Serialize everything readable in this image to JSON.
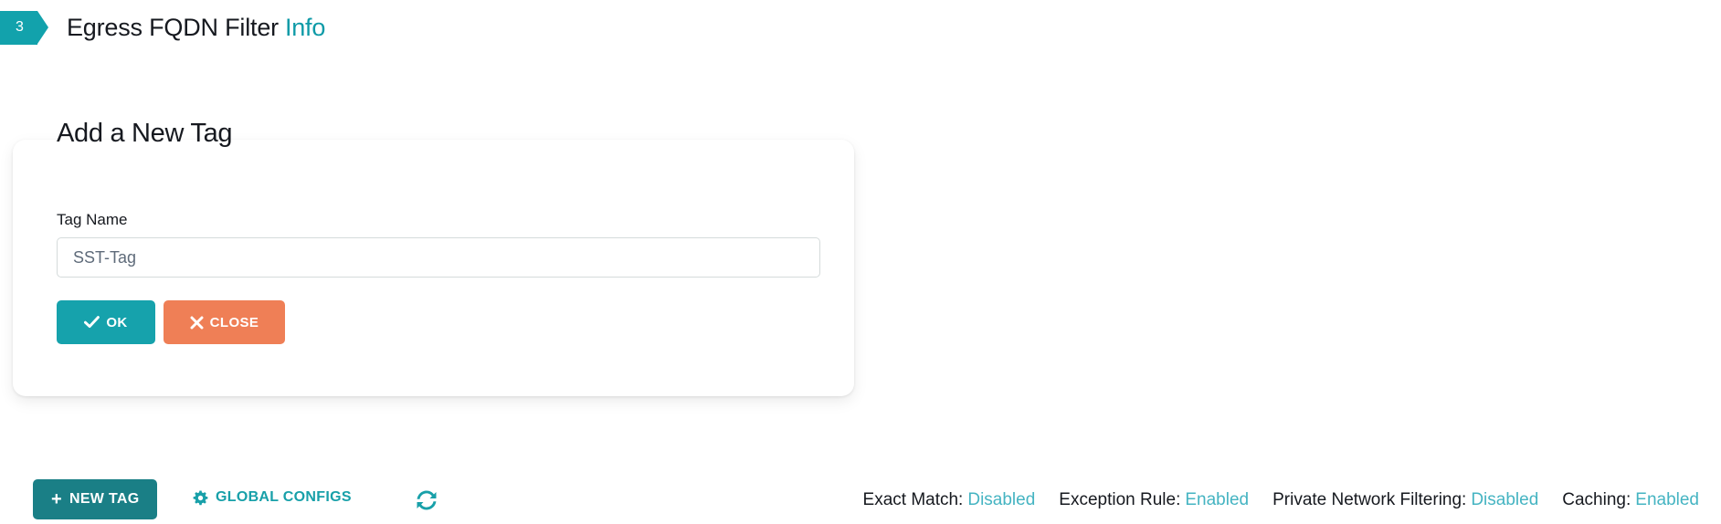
{
  "header": {
    "step_number": "3",
    "title": "Egress FQDN Filter",
    "info_link": "Info"
  },
  "card": {
    "title": "Add a New Tag",
    "field_label": "Tag Name",
    "input_value": "SST-Tag",
    "input_placeholder": "SST-Tag",
    "ok_button": "OK",
    "close_button": "CLOSE"
  },
  "toolbar": {
    "new_tag_button": "NEW TAG",
    "new_tag_plus": "+",
    "global_configs": "GLOBAL CONFIGS",
    "refresh_icon": "refresh-icon",
    "gear_icon": "gear-icon"
  },
  "status": [
    {
      "label": "Exact Match:",
      "value": "Disabled"
    },
    {
      "label": "Exception Rule:",
      "value": "Enabled"
    },
    {
      "label": "Private Network Filtering:",
      "value": "Disabled"
    },
    {
      "label": "Caching:",
      "value": "Enabled"
    }
  ],
  "colors": {
    "teal": "#12a2ac",
    "teal_dark": "#1a7f86",
    "coral": "#ef7f56",
    "status_value": "#45b4c2",
    "link": "#0e9aa7"
  }
}
